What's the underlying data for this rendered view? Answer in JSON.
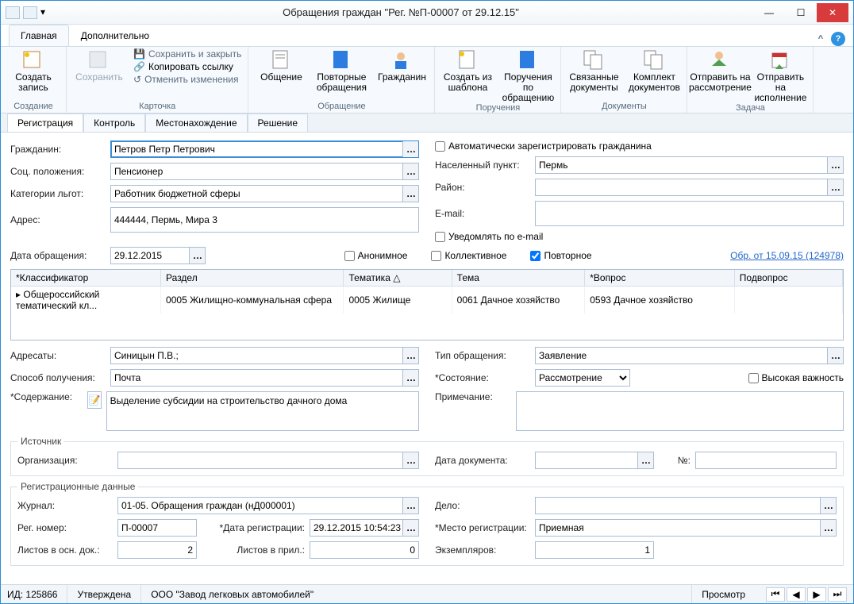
{
  "window": {
    "title": "Обращения граждан \"Рег. №П-00007 от 29.12.15\""
  },
  "ribbon_tabs": {
    "main": "Главная",
    "extra": "Дополнительно"
  },
  "ribbon": {
    "g1": {
      "label": "Создание",
      "create": "Создать\nзапись"
    },
    "g2": {
      "label": "Карточка",
      "save": "Сохранить",
      "save_close": "Сохранить и закрыть",
      "copy": "Копировать ссылку",
      "undo": "Отменить изменения"
    },
    "g3": {
      "label": "Обращение",
      "a": "Общение",
      "b": "Повторные\nобращения",
      "c": "Гражданин"
    },
    "g4": {
      "label": "Поручения",
      "a": "Создать из\nшаблона",
      "b": "Поручения по\nобращению"
    },
    "g5": {
      "label": "Документы",
      "a": "Связанные\nдокументы",
      "b": "Комплект\nдокументов"
    },
    "g6": {
      "label": "Задача",
      "a": "Отправить на\nрассмотрение",
      "b": "Отправить на\nисполнение"
    }
  },
  "subtabs": {
    "a": "Регистрация",
    "b": "Контроль",
    "c": "Местонахождение",
    "d": "Решение"
  },
  "form": {
    "citizen_l": "Гражданин:",
    "citizen": "Петров Петр Петрович",
    "auto_reg": "Автоматически зарегистрировать гражданина",
    "soc_l": "Соц. положения:",
    "soc": "Пенсионер",
    "city_l": "Населенный пункт:",
    "city": "Пермь",
    "cat_l": "Категории льгот:",
    "cat": "Работник бюджетной сферы",
    "district_l": "Район:",
    "addr_l": "Адрес:",
    "addr": "444444, Пермь, Мира 3",
    "email_l": "E-mail:",
    "notify": "Уведомлять по e-mail",
    "date_l": "Дата обращения:",
    "date": "29.12.2015",
    "anon": "Анонимное",
    "coll": "Коллективное",
    "repeat": "Повторное",
    "link": "Обр.  от 15.09.15 (124978)",
    "grid": {
      "h1": "*Классификатор",
      "h2": "Раздел",
      "h3": "Тематика",
      "h4": "Тема",
      "h5": "*Вопрос",
      "h6": "Подвопрос",
      "r1c1": "Общероссийский тематический кл...",
      "r1c2": "0005 Жилищно-коммунальная сфера",
      "r1c3": "0005 Жилище",
      "r1c4": "0061 Дачное хозяйство",
      "r1c5": "0593 Дачное хозяйство"
    },
    "adr_l": "Адресаты:",
    "adr": "Синицын П.В.;",
    "type_l": "Тип обращения:",
    "type": "Заявление",
    "way_l": "Способ получения:",
    "way": "Почта",
    "state_l": "*Состояние:",
    "state": "Рассмотрение",
    "high": "Высокая важность",
    "cont_l": "*Содержание:",
    "cont": "Выделение субсидии на строительство дачного дома",
    "note_l": "Примечание:",
    "src_legend": "Источник",
    "org_l": "Организация:",
    "docdate_l": "Дата документа:",
    "no_l": "№:",
    "reg_legend": "Регистрационные данные",
    "jrn_l": "Журнал:",
    "jrn": "01-05. Обращения граждан (нД000001)",
    "case_l": "Дело:",
    "num_l": "Рег. номер:",
    "num": "П-00007",
    "rdate_l": "*Дата регистрации:",
    "rdate": "29.12.2015 10:54:23",
    "place_l": "*Место регистрации:",
    "place": "Приемная",
    "sheets_l": "Листов в осн. док.:",
    "sheets": "2",
    "att_l": "Листов в прил.:",
    "att": "0",
    "copies_l": "Экземпляров:",
    "copies": "1"
  },
  "status": {
    "id": "ИД: 125866",
    "st": "Утверждена",
    "org": "ООО \"Завод легковых автомобилей\"",
    "view": "Просмотр"
  }
}
